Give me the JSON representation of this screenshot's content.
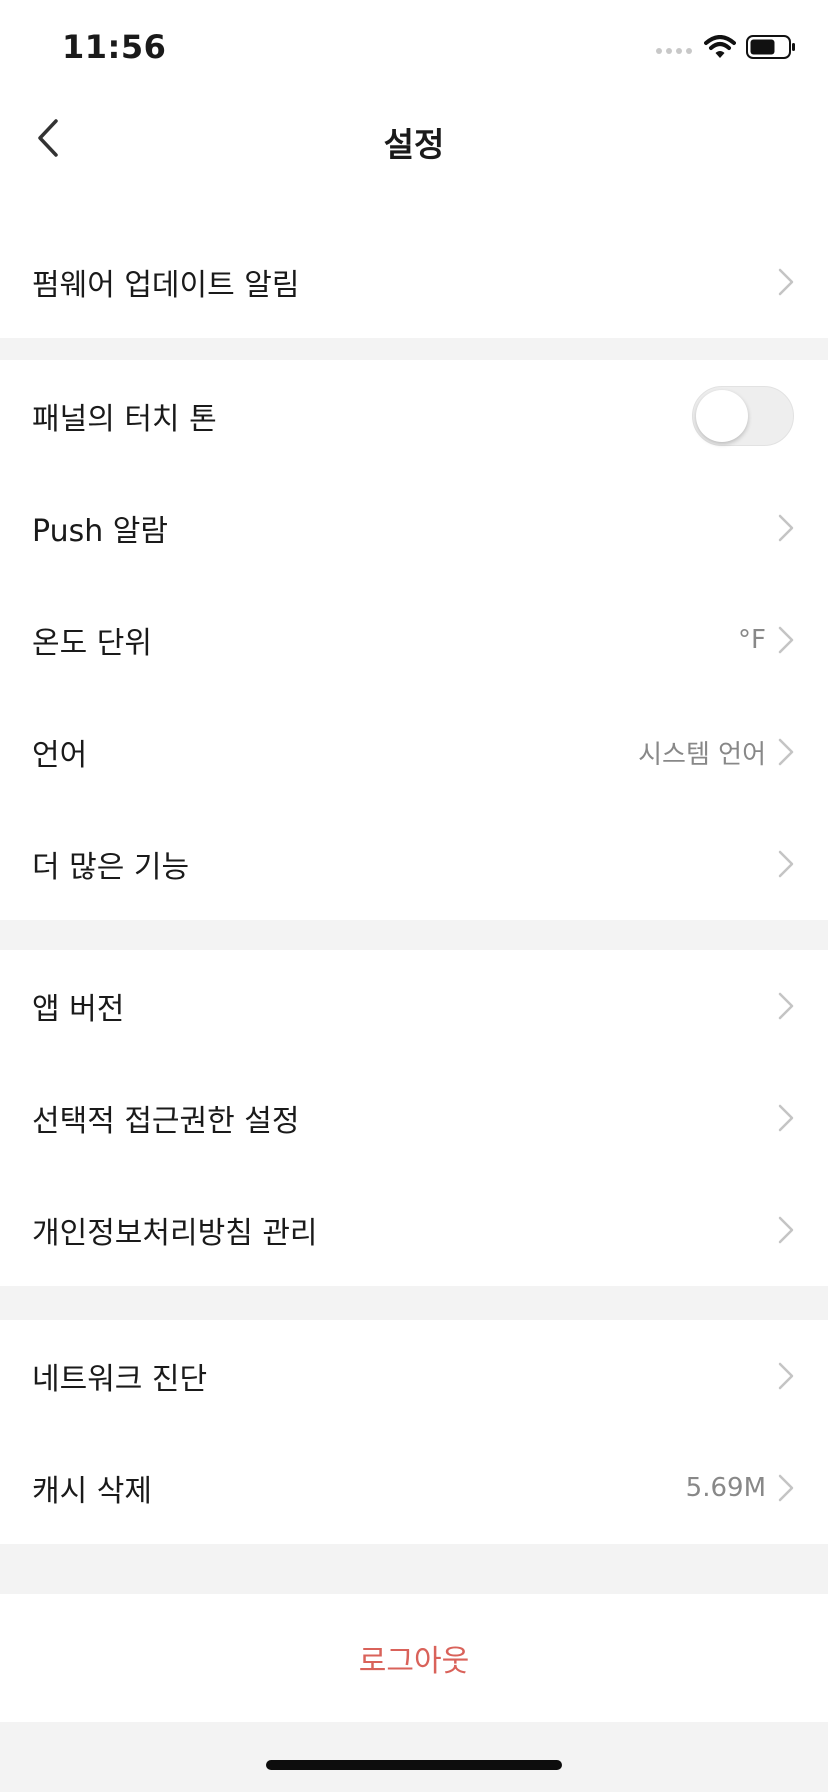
{
  "status_bar": {
    "time": "11:56",
    "icons": [
      "signal-icon",
      "wifi-icon",
      "battery-icon"
    ]
  },
  "nav": {
    "title": "설정",
    "back_icon": "chevron-left-icon"
  },
  "groups": [
    {
      "items": [
        {
          "label": "펌웨어 업데이트 알림",
          "control": "chevron"
        }
      ]
    },
    {
      "items": [
        {
          "label": "패널의 터치 톤",
          "control": "toggle",
          "toggle_on": false
        },
        {
          "label": "Push 알람",
          "control": "chevron"
        },
        {
          "label": "온도 단위",
          "value": "°F",
          "control": "chevron"
        },
        {
          "label": "언어",
          "value": "시스템 언어",
          "control": "chevron"
        },
        {
          "label": "더 많은 기능",
          "control": "chevron"
        }
      ]
    },
    {
      "items": [
        {
          "label": "앱 버전",
          "control": "chevron"
        },
        {
          "label": "선택적 접근권한 설정",
          "control": "chevron"
        },
        {
          "label": "개인정보처리방침 관리",
          "control": "chevron"
        }
      ]
    },
    {
      "items": [
        {
          "label": "네트워크 진단",
          "control": "chevron"
        },
        {
          "label": "캐시 삭제",
          "value": "5.69M",
          "control": "chevron"
        }
      ]
    }
  ],
  "logout": {
    "label": "로그아웃"
  },
  "colors": {
    "background": "#f3f3f3",
    "surface": "#ffffff",
    "logout_text": "#d9625a",
    "secondary_text": "#888888",
    "chevron": "#c4c4c4"
  }
}
